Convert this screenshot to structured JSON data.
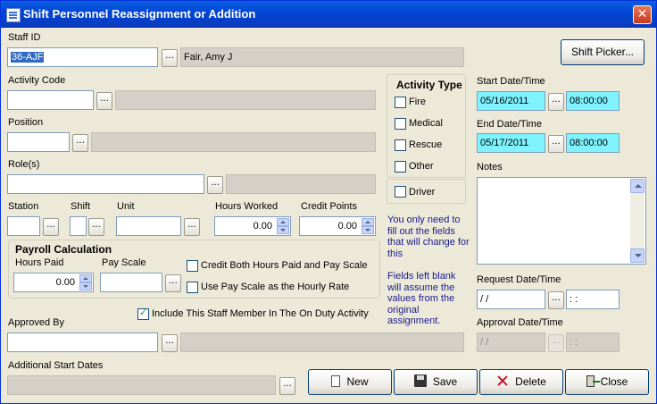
{
  "window": {
    "title": "Shift Personnel Reassignment or Addition",
    "close_glyph": "✕"
  },
  "staff": {
    "label": "Staff ID",
    "id_value": "36-AJF",
    "name_value": "Fair, Amy J"
  },
  "shift_picker_label": "Shift Picker...",
  "ellipsis": "...",
  "activity_code": {
    "label": "Activity Code",
    "value": "",
    "desc": ""
  },
  "position": {
    "label": "Position",
    "value": "",
    "desc": ""
  },
  "roles": {
    "label": "Role(s)",
    "value": "",
    "desc": ""
  },
  "activity_type": {
    "title": "Activity Type",
    "options": [
      {
        "label": "Fire",
        "checked": false
      },
      {
        "label": "Medical",
        "checked": false
      },
      {
        "label": "Rescue",
        "checked": false
      },
      {
        "label": "Other",
        "checked": false
      }
    ],
    "driver_label": "Driver"
  },
  "station": {
    "label": "Station",
    "value": ""
  },
  "shift": {
    "label": "Shift",
    "value": ""
  },
  "unit": {
    "label": "Unit",
    "value": ""
  },
  "hours_worked": {
    "label": "Hours Worked",
    "value": "0.00"
  },
  "credit_points": {
    "label": "Credit Points",
    "value": "0.00"
  },
  "payroll": {
    "title": "Payroll Calculation",
    "hours_paid_label": "Hours Paid",
    "hours_paid_value": "0.00",
    "pay_scale_label": "Pay Scale",
    "pay_scale_value": "",
    "credit_both_label": "Credit Both Hours Paid and Pay Scale",
    "use_pay_scale_label": "Use Pay Scale as the Hourly Rate"
  },
  "include_on_duty_label": "Include This Staff Member In The On Duty Activity",
  "approved_by": {
    "label": "Approved By",
    "value": "",
    "desc": ""
  },
  "additional_start_dates": {
    "label": "Additional Start Dates",
    "value": ""
  },
  "info_note_1": "You only need to fill out the fields that will change for this",
  "info_note_2": "Fields left blank will assume the values from the original assignment.",
  "start": {
    "label": "Start Date/Time",
    "date": "05/16/2011",
    "time": "08:00:00"
  },
  "end": {
    "label": "End Date/Time",
    "date": "05/17/2011",
    "time": "08:00:00"
  },
  "notes": {
    "label": "Notes",
    "value": ""
  },
  "request": {
    "label": "Request Date/Time",
    "date": " / /",
    "time": " : :"
  },
  "approval": {
    "label": "Approval Date/Time",
    "date": " / /",
    "time": " : :"
  },
  "buttons": {
    "new": "New",
    "save": "Save",
    "delete": "Delete",
    "close": "Close"
  },
  "colors": {
    "highlight_field": "#7ff3ff",
    "note_text": "#1a1a8c",
    "titlebar": "#0a5fe0"
  }
}
